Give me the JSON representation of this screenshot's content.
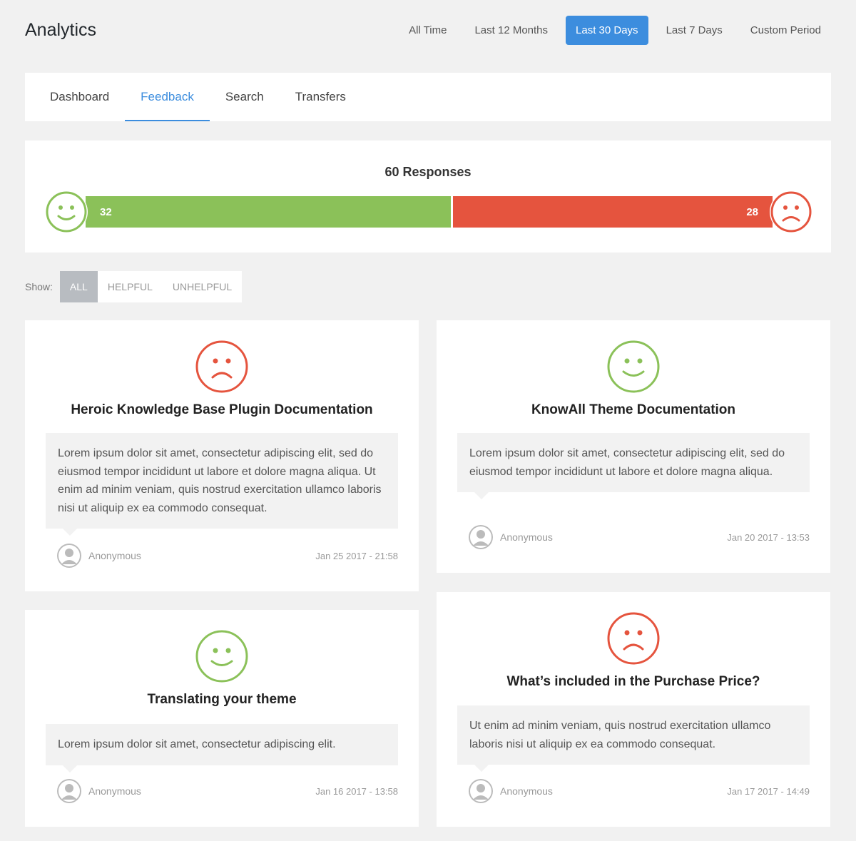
{
  "header": {
    "title": "Analytics",
    "periods": [
      {
        "label": "All Time",
        "active": false
      },
      {
        "label": "Last 12 Months",
        "active": false
      },
      {
        "label": "Last 30 Days",
        "active": true
      },
      {
        "label": "Last 7 Days",
        "active": false
      },
      {
        "label": "Custom Period",
        "active": false
      }
    ]
  },
  "tabs": [
    {
      "label": "Dashboard",
      "active": false
    },
    {
      "label": "Feedback",
      "active": true
    },
    {
      "label": "Search",
      "active": false
    },
    {
      "label": "Transfers",
      "active": false
    }
  ],
  "summary": {
    "title": "60 Responses",
    "positive": 32,
    "negative": 28
  },
  "filter": {
    "label": "Show:",
    "options": [
      {
        "label": "ALL",
        "active": true
      },
      {
        "label": "HELPFUL",
        "active": false
      },
      {
        "label": "UNHELPFUL",
        "active": false
      }
    ]
  },
  "colors": {
    "accent": "#3c8dde",
    "positive": "#8bc159",
    "negative": "#e5543e"
  },
  "feedback": [
    {
      "sentiment": "negative",
      "icon": "sad-face-icon",
      "title": "Heroic Knowledge Base Plugin Documentation",
      "comment": "Lorem ipsum dolor sit amet, consectetur adipiscing elit, sed do eiusmod tempor incididunt ut labore et dolore magna aliqua. Ut enim ad minim veniam, quis nostrud exercitation ullamco laboris nisi ut aliquip ex ea commodo consequat.",
      "author": "Anonymous",
      "date": "Jan 25 2017 - 21:58"
    },
    {
      "sentiment": "positive",
      "icon": "happy-face-icon",
      "title": "KnowAll Theme Documentation",
      "comment": "Lorem ipsum dolor sit amet, consectetur adipiscing elit, sed do eiusmod tempor incididunt ut labore et dolore magna aliqua.",
      "author": "Anonymous",
      "date": "Jan 20 2017 - 13:53"
    },
    {
      "sentiment": "positive",
      "icon": "happy-face-icon",
      "title": "Translating your theme",
      "comment": "Lorem ipsum dolor sit amet, consectetur adipiscing elit.",
      "author": "Anonymous",
      "date": "Jan 16 2017 - 13:58"
    },
    {
      "sentiment": "negative",
      "icon": "sad-face-icon",
      "title": "What’s included in the Purchase Price?",
      "comment": "Ut enim ad minim veniam, quis nostrud exercitation ullamco laboris nisi ut aliquip ex ea commodo consequat.",
      "author": "Anonymous",
      "date": "Jan 17 2017 - 14:49"
    }
  ]
}
